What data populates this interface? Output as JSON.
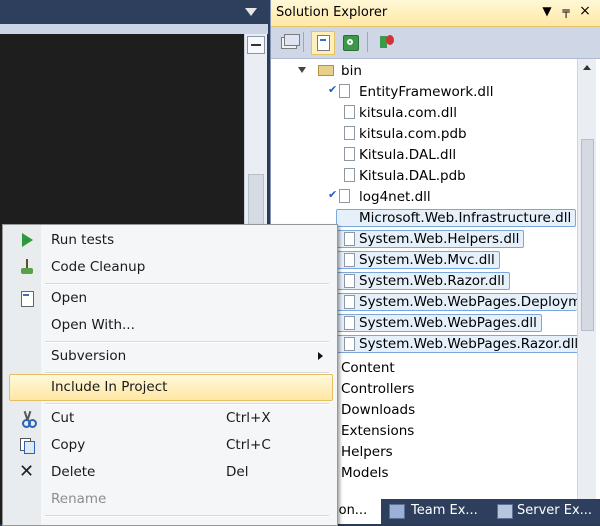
{
  "solution_explorer": {
    "title": "Solution Explorer",
    "title_buttons": [
      "▼",
      "╤",
      "×"
    ],
    "toolbar_icons": [
      "show-all-files-icon",
      "properties-icon",
      "refresh-icon",
      "class-diagram-icon"
    ],
    "tree": [
      {
        "label": "bin",
        "type": "folder",
        "expanded": true
      },
      {
        "label": "EntityFramework.dll",
        "type": "file",
        "checked": true
      },
      {
        "label": "kitsula.com.dll",
        "type": "file"
      },
      {
        "label": "kitsula.com.pdb",
        "type": "file"
      },
      {
        "label": "Kitsula.DAL.dll",
        "type": "file"
      },
      {
        "label": "Kitsula.DAL.pdb",
        "type": "file"
      },
      {
        "label": "log4net.dll",
        "type": "file",
        "checked": true
      },
      {
        "label": "Microsoft.Web.Infrastructure.dll",
        "type": "file",
        "selected": true
      },
      {
        "label": "System.Web.Helpers.dll",
        "type": "file",
        "selected": true
      },
      {
        "label": "System.Web.Mvc.dll",
        "type": "file",
        "selected": true
      },
      {
        "label": "System.Web.Razor.dll",
        "type": "file",
        "selected": true
      },
      {
        "label": "System.Web.WebPages.Deployme",
        "type": "file",
        "selected": true
      },
      {
        "label": "System.Web.WebPages.dll",
        "type": "file",
        "selected": true
      },
      {
        "label": "System.Web.WebPages.Razor.dll",
        "type": "file",
        "selected": true
      },
      {
        "label": "Content",
        "type": "folder"
      },
      {
        "label": "Controllers",
        "type": "folder"
      },
      {
        "label": "Downloads",
        "type": "folder"
      },
      {
        "label": "Extensions",
        "type": "folder"
      },
      {
        "label": "Helpers",
        "type": "folder"
      },
      {
        "label": "Models",
        "type": "folder"
      }
    ],
    "tabs": [
      {
        "label": "ion...",
        "active": true
      },
      {
        "label": "Team Ex...",
        "active": false
      },
      {
        "label": "Server Ex...",
        "active": false
      }
    ]
  },
  "context_menu": {
    "items": [
      {
        "label": "Run tests",
        "shortcut": "",
        "icon": "run-tests-icon"
      },
      {
        "label": "Code Cleanup",
        "shortcut": "",
        "icon": "broom-icon"
      },
      {
        "label": "Open",
        "shortcut": "",
        "icon": "open-file-icon"
      },
      {
        "label": "Open With...",
        "shortcut": "",
        "icon": ""
      },
      {
        "label": "Subversion",
        "shortcut": "",
        "icon": "",
        "submenu": true
      },
      {
        "label": "Include In Project",
        "shortcut": "",
        "icon": "",
        "hover": true
      },
      {
        "label": "Cut",
        "shortcut": "Ctrl+X",
        "icon": "scissors-icon"
      },
      {
        "label": "Copy",
        "shortcut": "Ctrl+C",
        "icon": "copy-icon"
      },
      {
        "label": "Delete",
        "shortcut": "Del",
        "icon": "delete-icon"
      },
      {
        "label": "Rename",
        "shortcut": "",
        "icon": "",
        "disabled": true
      }
    ]
  },
  "colors": {
    "accent_highlight": "#ffe7a3",
    "selection_border": "#7aa7dc",
    "chrome_background": "#2d3f5d"
  }
}
